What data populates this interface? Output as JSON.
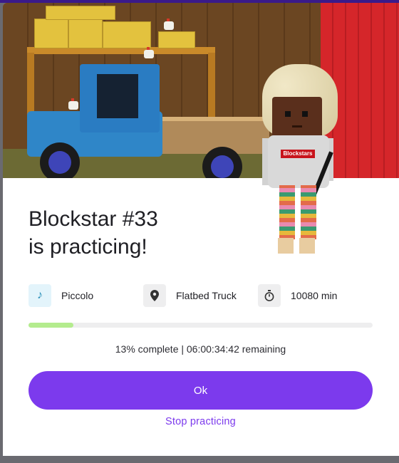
{
  "dialog": {
    "title_line1": "Blockstar #33",
    "title_line2": "is practicing!",
    "hoodie_text": "Blockstars"
  },
  "activity": {
    "instrument": {
      "label": "Piccolo",
      "icon": "music-note-icon"
    },
    "location": {
      "label": "Flatbed Truck",
      "icon": "location-pin-icon"
    },
    "duration": {
      "label": "10080 min",
      "icon": "stopwatch-icon"
    }
  },
  "progress": {
    "fraction": 0.13,
    "text": "13% complete | 06:00:34:42 remaining"
  },
  "actions": {
    "ok_label": "Ok",
    "stop_label": "Stop practicing"
  },
  "colors": {
    "accent": "#7c3aed",
    "progress_fill": "#b4ec8e",
    "instrument_icon_bg": "#e3f4fb",
    "neutral_icon_bg": "#eeeeef"
  }
}
